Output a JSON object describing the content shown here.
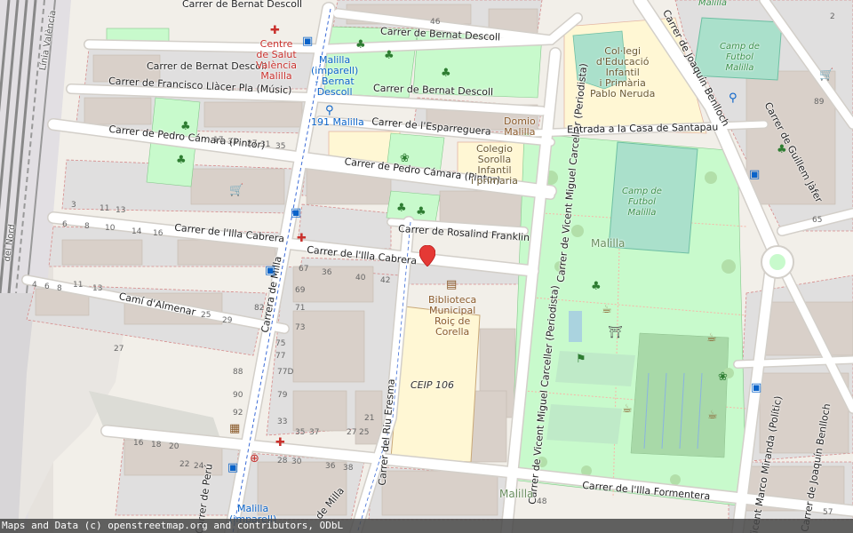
{
  "streets": {
    "bernat_descoll_1": "Carrer de Bernat Descoll",
    "bernat_descoll_2": "Carrer de Bernat Descoll",
    "bernat_descoll_3": "Carrer de Bernat Descoll",
    "bernat_descoll_top": "Carrer de Bernat Descoll",
    "francisco_llacer": "Carrer de Francisco Llàcer Pla (Músic)",
    "pedro_camara_1": "Carrer de Pedro Cámara (Pintor)",
    "pedro_camara_2": "Carrer de Pedro Cámara (Pintor)",
    "esparreguera": "Carrer de l'Esparreguera",
    "rosalind": "Carrer de Rosalind Franklin",
    "illa_cabrera_1": "Carrer de l'Illa Cabrera",
    "illa_cabrera_2": "Carrer de l'Illa Cabrera",
    "cami_almenar": "Camí d'Almenar",
    "carrera_milla": "Carrera de Milla",
    "riu_eresma": "Carrer del Riu Eresma",
    "vicent_miguel_1": "Carrer de Vicent Miguel Carceller (Periodista)",
    "vicent_miguel_2": "Carrer de Vicent Miguel Carceller (Periodista)",
    "entrada_santapau": "Entrada a la Casa de Santapau",
    "joaquin_benlloch_1": "Carrer de Joaquín Benlloch",
    "joaquin_benlloch_2": "Carrer de Joaquín Benlloch",
    "guillem_jafer": "Carrer de Guillem Jàfer",
    "vicent_marco": "Vicent Marco Miranda (Polític)",
    "illa_formentera": "Carrer de l'Illa Formentera",
    "milla_partial": "de Milla",
    "peru": "Carrer de Perú",
    "rail_1": "Línia València",
    "rail_2": "del Nord"
  },
  "pois": {
    "centre_salut": "Centre\nde Salut\nValència\nMalilla",
    "bus_imparell": "Malilla\n(imparell)\n- Bernat\nDescoll",
    "bike_191": "191 Malilla",
    "domio": "Domio\nMalilla",
    "colegio_sorolla": "Colegio\nSorolla\nInfantil\ni primaria",
    "col_legi": "Col·legi\nd'Educació\nInfantil\ni Primària\nPablo Neruda",
    "camp_futbol_1": "Camp de\nFutbol\nMalilla",
    "camp_futbol_2": "Camp de\nFutbol\nMalilla",
    "biblioteca": "Biblioteca\nMunicipal\nRoiç de\nCorella",
    "ceip": "CEIP 106",
    "malilla_park": "Malilla",
    "malilla_bottom": "Malilla",
    "malilla_top": "Malilla",
    "malilla_bus_bottom": "Malilla\n(imparell)"
  },
  "house_numbers": [
    "46",
    "17",
    "31",
    "27",
    "31",
    "35",
    "3",
    "11",
    "13",
    "6",
    "8",
    "10",
    "14",
    "16",
    "67",
    "36",
    "40",
    "42",
    "4",
    "6",
    "8",
    "11",
    "13",
    "69",
    "71",
    "73",
    "82",
    "25",
    "29",
    "75",
    "77",
    "27",
    "88",
    "90",
    "77D",
    "79",
    "92",
    "33",
    "35",
    "37",
    "27",
    "25",
    "21",
    "16",
    "18",
    "20",
    "22",
    "24",
    "28",
    "30",
    "36",
    "38",
    "48",
    "57",
    "65",
    "2",
    "89"
  ],
  "attribution": "Maps and Data (c) openstreetmap.org and contributors, ODbL",
  "colors": {
    "background": "#f2efe9",
    "building": "#d9d0c9",
    "park": "#c8facc",
    "pitch": "#aae0cb",
    "school": "#fff7d4",
    "residential": "#e0dfdf",
    "road": "#ffffff",
    "rail": "#707070",
    "marker": "#e53935"
  },
  "icons": {
    "marker": "location-pin-icon",
    "health": "health-centre-icon",
    "bus": "bus-stop-icon",
    "bike": "bicycle-icon",
    "library": "library-icon",
    "shop": "shopping-cart-icon",
    "tree": "playground-icon",
    "dog": "dog-park-icon"
  }
}
